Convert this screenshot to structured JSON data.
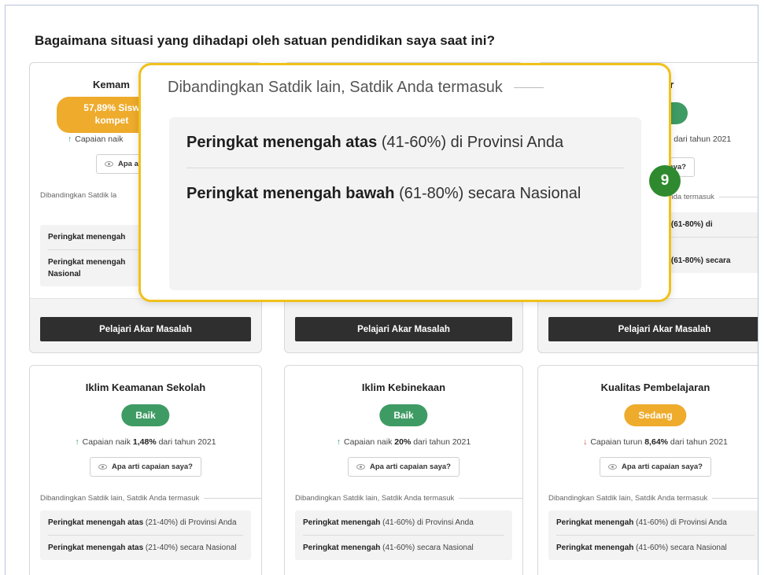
{
  "page_title": "Bagaimana situasi yang dihadapi oleh satuan pendidikan saya saat ini?",
  "top_cards": [
    {
      "title": "Kemam",
      "badge": "57,89% Sisw\nkompet",
      "trend_prefix": "Capaian naik",
      "help": "Apa a",
      "compare": "Dibandingkan Satdik la",
      "rows": [
        "Peringkat menengah",
        "Peringkat menengah\nNasional"
      ],
      "learn": "Pelajari Akar Masalah"
    },
    {
      "learn": "Pelajari Akar Masalah"
    },
    {
      "title": "er",
      "trend_suffix": "% dari tahun 2021",
      "help": "saya?",
      "compare": "Anda termasuk",
      "rows": [
        "h (61-80%) di",
        "h (61-80%) secara"
      ],
      "learn": "Pelajari Akar Masalah"
    }
  ],
  "bottom_cards": [
    {
      "title": "Iklim Keamanan Sekolah",
      "badge": "Baik",
      "badge_color": "#3f9b64",
      "trend_dir": "up",
      "trend_pre": "Capaian naik",
      "trend_value": "1,48%",
      "trend_post": "dari tahun 2021",
      "help": "Apa arti capaian saya?",
      "compare": "Dibandingkan Satdik lain, Satdik Anda termasuk",
      "row1_bold": "Peringkat menengah atas",
      "row1_rest": " (21-40%) di Provinsi Anda",
      "row2_bold": "Peringkat menengah atas",
      "row2_rest": " (21-40%) secara Nasional"
    },
    {
      "title": "Iklim Kebinekaan",
      "badge": "Baik",
      "badge_color": "#3f9b64",
      "trend_dir": "up",
      "trend_pre": "Capaian naik",
      "trend_value": "20%",
      "trend_post": "dari tahun 2021",
      "help": "Apa arti capaian saya?",
      "compare": "Dibandingkan Satdik lain, Satdik Anda termasuk",
      "row1_bold": "Peringkat menengah",
      "row1_rest": " (41-60%) di Provinsi Anda",
      "row2_bold": "Peringkat menengah",
      "row2_rest": " (41-60%) secara Nasional"
    },
    {
      "title": "Kualitas Pembelajaran",
      "badge": "Sedang",
      "badge_color": "#eeab2c",
      "trend_dir": "down",
      "trend_pre": "Capaian turun",
      "trend_value": "8,64%",
      "trend_post": "dari tahun 2021",
      "help": "Apa arti capaian saya?",
      "compare": "Dibandingkan Satdik lain, Satdik Anda termasuk",
      "row1_bold": "Peringkat menengah",
      "row1_rest": "  (41-60%) di Provinsi Anda",
      "row2_bold": "Peringkat menengah",
      "row2_rest": "  (41-60%) secara Nasional"
    }
  ],
  "overlay": {
    "heading": "Dibandingkan Satdik lain, Satdik Anda termasuk",
    "row1_bold": "Peringkat menengah atas",
    "row1_rest": " (41-60%) di Provinsi Anda",
    "row2_bold": "Peringkat menengah bawah",
    "row2_rest": " (61-80%) secara Nasional"
  },
  "step_number": "9",
  "colors": {
    "highlight_border": "#f0c11b",
    "step_badge": "#2f8a2f",
    "button_dark": "#2f2f2f"
  }
}
